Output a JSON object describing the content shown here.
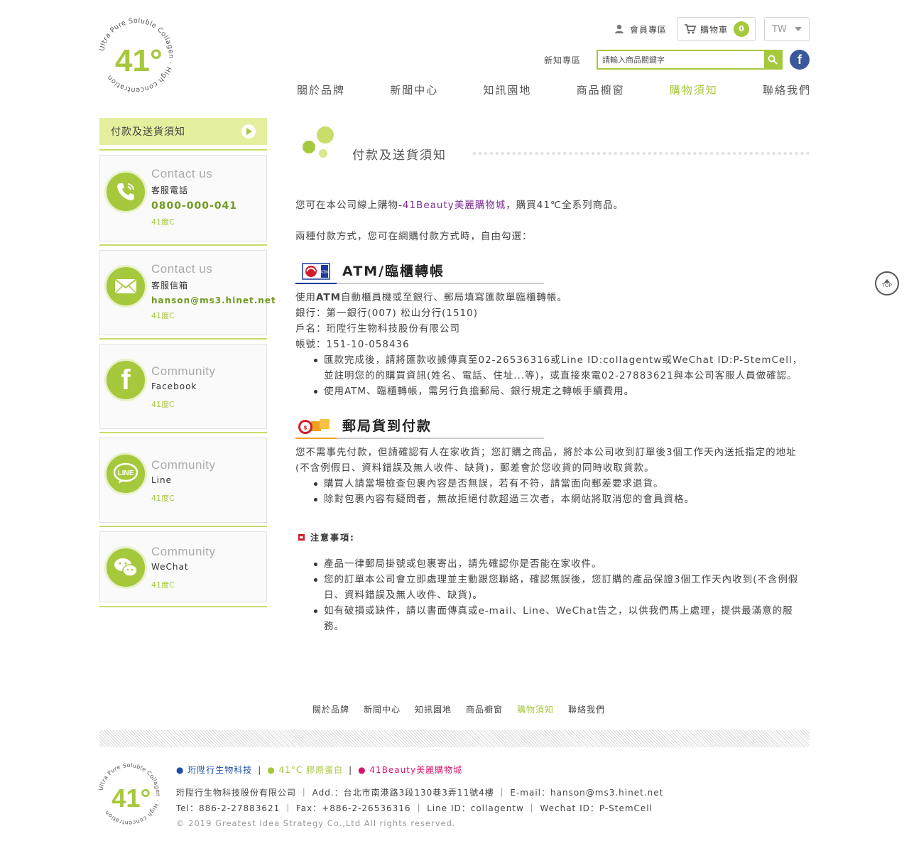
{
  "header": {
    "logo_text": "41°",
    "logo_ring_text": "Ultra Pure Soluble Collagen · High concentration",
    "member_label": "會員專區",
    "cart_label": "購物車",
    "cart_count": "0",
    "lang": "TW",
    "news_link": "新知專區",
    "search_placeholder": "請輸入商品關鍵字",
    "fb_letter": "f"
  },
  "nav": [
    "關於品牌",
    "新聞中心",
    "知訊園地",
    "商品櫥窗",
    "購物須知",
    "聯絡我們"
  ],
  "nav_active_index": 4,
  "sidebar": {
    "title": "付款及送貨須知",
    "cards": [
      {
        "icon": "phone-icon",
        "title": "Contact us",
        "sub": "客服電話",
        "value": "0800-000-041",
        "brand": "41度C"
      },
      {
        "icon": "mail-icon",
        "title": "Contact us",
        "sub": "客服信箱",
        "value": "hanson@ms3.hinet.net",
        "brand": "41度C"
      },
      {
        "icon": "facebook-icon",
        "title": "Community",
        "sub": "Facebook",
        "value": "",
        "brand": "41度C"
      },
      {
        "icon": "line-icon",
        "title": "Community",
        "sub": "Line",
        "value": "",
        "brand": "41度C"
      },
      {
        "icon": "wechat-icon",
        "title": "Community",
        "sub": "WeChat",
        "value": "",
        "brand": "41度C"
      }
    ]
  },
  "content": {
    "title": "付款及送貨須知",
    "intro1_pre": "您可在本公司線上購物-",
    "intro1_brand": "41Beauty美麗購物城",
    "intro1_post": "，購買41℃全系列商品。",
    "intro2": "兩種付款方式，您可在網購付款方式時，自由勾選：",
    "atm": {
      "title": "ATM/臨櫃轉帳",
      "line1_pre": "使用",
      "line1_bold": "ATM",
      "line1_post": "自動櫃員機或至銀行、郵局填寫匯款單臨櫃轉帳。",
      "bank": "銀行：第一銀行(007)  松山分行(1510)",
      "account_name": "戶名：珩陞行生物科技股份有限公司",
      "account_no": "帳號：151-10-058436",
      "bullets": [
        "匯款完成後，請將匯款收據傳真至02-26536316或Line ID:collagentw或WeChat ID:P-StemCell，並註明您的的購買資訊(姓名、電話、住址...等)，或直接來電02-27883621與本公司客服人員做確認。",
        "使用ATM、臨櫃轉帳，需另行負擔郵局、銀行規定之轉帳手續費用。"
      ]
    },
    "post": {
      "title": "郵局貨到付款",
      "para": "您不需事先付款，但請確認有人在家收貨；您訂購之商品，將於本公司收到訂單後3個工作天內送抵指定的地址(不含例假日、資料錯誤及無人收件、缺貨)，郵差會於您收貨的同時收取貨款。",
      "bullets": [
        "購買人請當場檢查包裹內容是否無誤，若有不符，請當面向郵差要求退貨。",
        "除對包裹內容有疑問者，無故拒絕付款超過三次者，本網站將取消您的會員資格。"
      ]
    },
    "notes": {
      "title": "注意事項:",
      "bullets": [
        "產品一律郵局掛號或包裹寄出，請先確認你是否能在家收件。",
        "您的訂單本公司會立即處理並主動跟您聯絡，確認無誤後，您訂購的產品保證3個工作天內收到(不含例假日、資料錯誤及無人收件、缺貨)。",
        "如有破損或缺件，請以書面傳真或e-mail、Line、WeChat告之，以供我們馬上處理，提供最滿意的服務。"
      ]
    }
  },
  "footer": {
    "nav": [
      "關於品牌",
      "新聞中心",
      "知訊園地",
      "商品櫥窗",
      "購物須知",
      "聯絡我們"
    ],
    "link1": "● 珩陞行生物科技",
    "link2": "● 41°C 膠原蛋白",
    "link3": "● 41Beauty美麗購物城",
    "sep": "|",
    "info1": "珩陞行生物科技股份有限公司 ｜ Add.：台北市南港路3段130巷3弄11號4樓 ｜ E-mail：hanson@ms3.hinet.net",
    "info2": "Tel：886-2-27883621 ｜ Fax：+886-2-26536316 ｜ Line ID：collagentw ｜ Wechat ID：P-StemCell",
    "copyright": "© 2019 Greatest Idea Strategy Co.,Ltd All rights reserved."
  },
  "top_button": "TOP",
  "colors": {
    "accent": "#a6c83c",
    "accent_light": "#e6ef9e",
    "brand_purple": "#7a2e8f",
    "facebook": "#3b5998"
  }
}
